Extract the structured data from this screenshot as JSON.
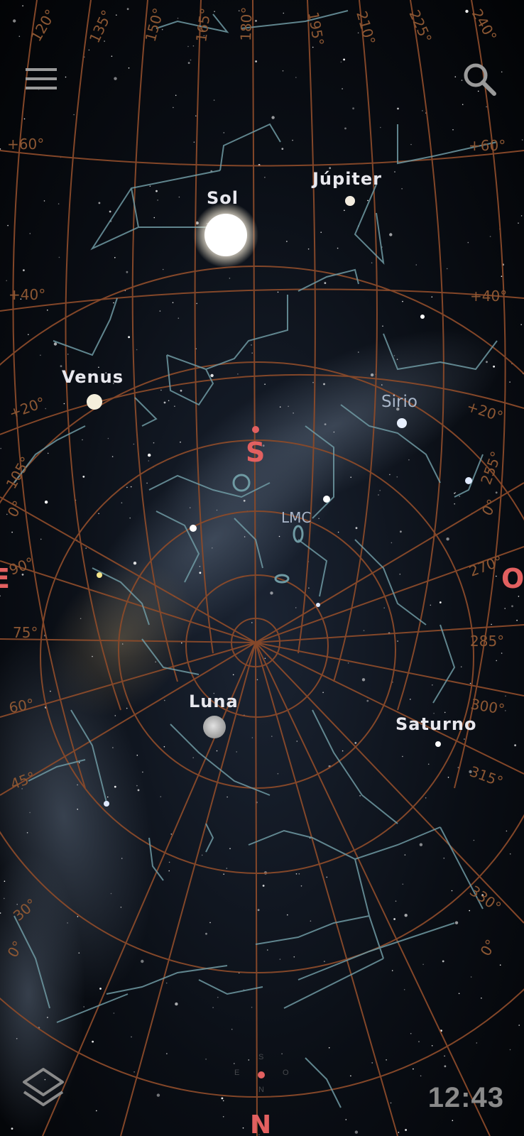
{
  "toolbar": {
    "menu_icon": "hamburger-menu-icon",
    "search_icon": "search-icon",
    "layers_icon": "layers-icon"
  },
  "clock": "12:43",
  "planets": [
    {
      "name": "Sol",
      "kind": "sun"
    },
    {
      "name": "Júpiter",
      "kind": "planet"
    },
    {
      "name": "Venus",
      "kind": "planet"
    },
    {
      "name": "Luna",
      "kind": "moon"
    },
    {
      "name": "Saturno",
      "kind": "planet"
    }
  ],
  "stars": [
    {
      "name": "Sirio"
    },
    {
      "name": "LMC"
    }
  ],
  "cardinals": [
    {
      "label": "S"
    },
    {
      "label": "N"
    },
    {
      "label": "E"
    },
    {
      "label": "O"
    }
  ],
  "compass_letters": [
    "S",
    "E",
    "O",
    "N"
  ],
  "azimuth_labels_top": [
    "120°",
    "135°",
    "150°",
    "165°",
    "180°",
    "195°",
    "210°",
    "225°",
    "240°"
  ],
  "declination_labels_left": [
    "+60°",
    "+40°",
    "+20°"
  ],
  "declination_labels_right": [
    "+60°",
    "+40°",
    "+20°"
  ],
  "ring_labels_left": [
    "105°",
    "0°",
    "90°",
    "75°",
    "60°",
    "45°",
    "30°",
    "0°"
  ],
  "ring_labels_right": [
    "255°",
    "0°",
    "270°",
    "285°",
    "300°",
    "315°",
    "330°",
    "0°"
  ],
  "colors": {
    "grid": "#8a4a2a",
    "constellation": "#6f9aa3",
    "cardinal": "#e26060",
    "label": "#e8e8ee",
    "clock": "#8a8a8a"
  }
}
